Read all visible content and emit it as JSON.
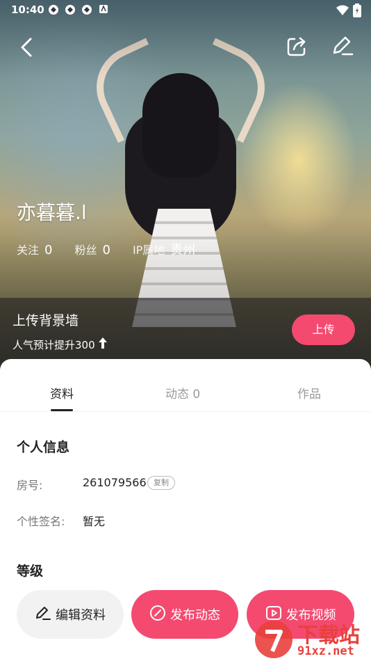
{
  "status_bar": {
    "time": "10:40"
  },
  "profile": {
    "name": "亦暮暮.l",
    "stats": [
      {
        "label": "关注",
        "value": "0"
      },
      {
        "label": "粉丝",
        "value": "0"
      },
      {
        "label": "IP属地",
        "value": "贵州"
      }
    ]
  },
  "upload_banner": {
    "title": "上传背景墙",
    "subtitle": "人气预计提升300",
    "button": "上传"
  },
  "tabs": [
    {
      "label": "资料",
      "active": true
    },
    {
      "label": "动态 0",
      "active": false
    },
    {
      "label": "作品",
      "active": false
    }
  ],
  "personal_info": {
    "title": "个人信息",
    "room_label": "房号:",
    "room_value": "261079566",
    "copy_label": "复制",
    "signature_label": "个性签名:",
    "signature_value": "暂无"
  },
  "level": {
    "title": "等级"
  },
  "actions": {
    "edit": "编辑资料",
    "post": "发布动态",
    "video": "发布视频"
  },
  "watermark": {
    "text": "下载站",
    "url": "91xz.net"
  },
  "colors": {
    "accent": "#f44a70",
    "secondary_bg": "#f2f2f2"
  }
}
